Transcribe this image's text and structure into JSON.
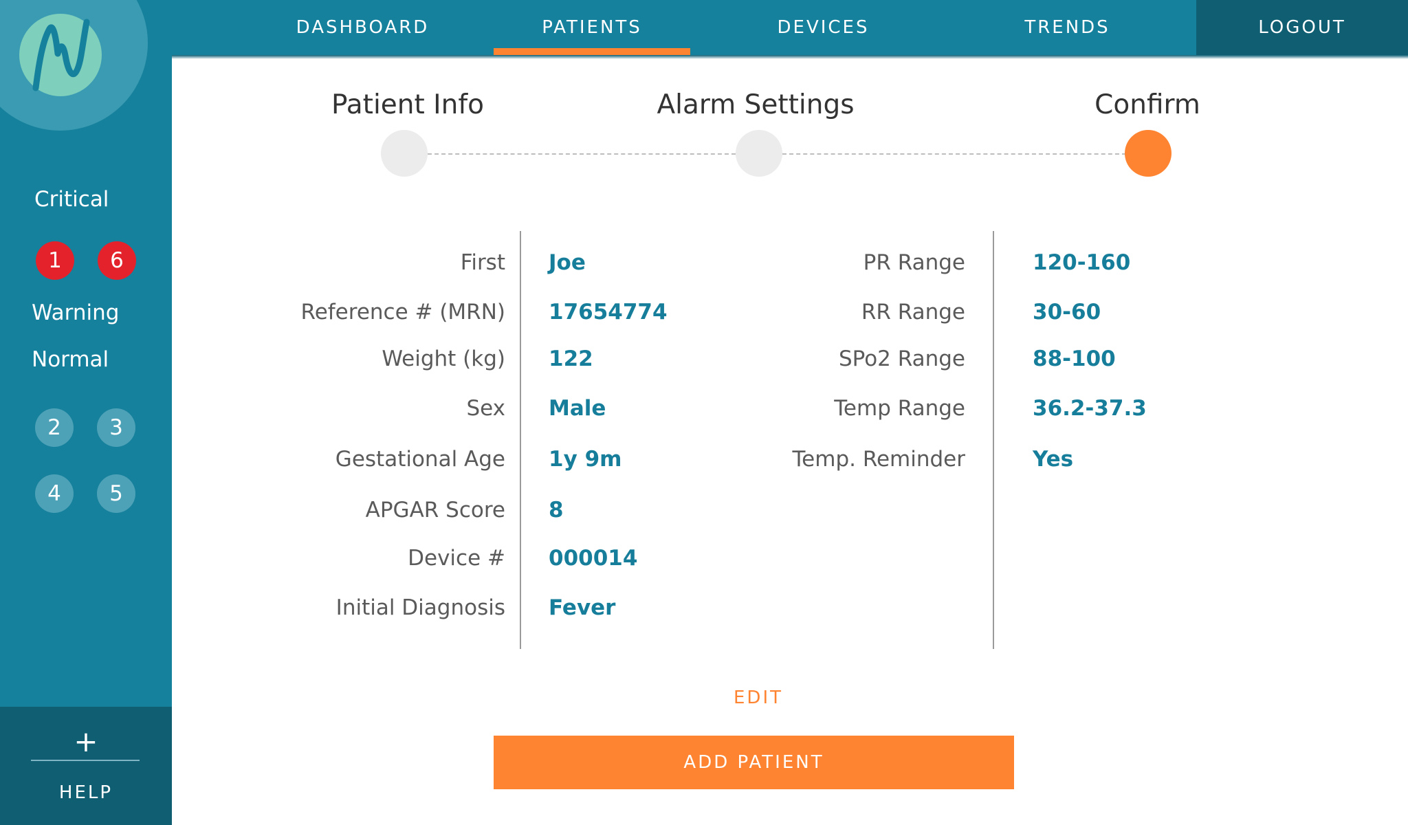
{
  "nav": {
    "items": [
      {
        "label": "DASHBOARD",
        "active": false
      },
      {
        "label": "PATIENTS",
        "active": true
      },
      {
        "label": "DEVICES",
        "active": false
      },
      {
        "label": "TRENDS",
        "active": false
      }
    ],
    "logout_label": "LOGOUT"
  },
  "sidebar": {
    "critical_label": "Critical",
    "critical_beds": [
      "1",
      "6"
    ],
    "warning_label": "Warning",
    "normal_label": "Normal",
    "normal_beds": [
      "2",
      "3",
      "4",
      "5"
    ],
    "add_icon": "+",
    "help_label": "HELP"
  },
  "stepper": {
    "steps": [
      {
        "label": "Patient Info",
        "state": "complete"
      },
      {
        "label": "Alarm Settings",
        "state": "complete"
      },
      {
        "label": "Confirm",
        "state": "active"
      }
    ]
  },
  "patient_info": [
    {
      "label": "First",
      "value": "Joe"
    },
    {
      "label": "Reference # (MRN)",
      "value": "17654774"
    },
    {
      "label": "Weight (kg)",
      "value": "122"
    },
    {
      "label": "Sex",
      "value": "Male"
    },
    {
      "label": "Gestational Age",
      "value": "1y 9m"
    },
    {
      "label": "APGAR Score",
      "value": "8"
    },
    {
      "label": "Device #",
      "value": "000014"
    },
    {
      "label": "Initial Diagnosis",
      "value": "Fever"
    }
  ],
  "alarm_settings": [
    {
      "label": "PR Range",
      "value": "120-160"
    },
    {
      "label": "RR Range",
      "value": "30-60"
    },
    {
      "label": "SPo2 Range",
      "value": "88-100"
    },
    {
      "label": "Temp Range",
      "value": "36.2-37.3"
    },
    {
      "label": "Temp. Reminder",
      "value": "Yes"
    }
  ],
  "actions": {
    "edit_label": "EDIT",
    "add_patient_label": "ADD PATIENT"
  },
  "colors": {
    "primary": "#16819d",
    "primary_dark": "#0f5e72",
    "accent": "#ff8431",
    "critical": "#e3222b",
    "value_text": "#167e9b"
  }
}
